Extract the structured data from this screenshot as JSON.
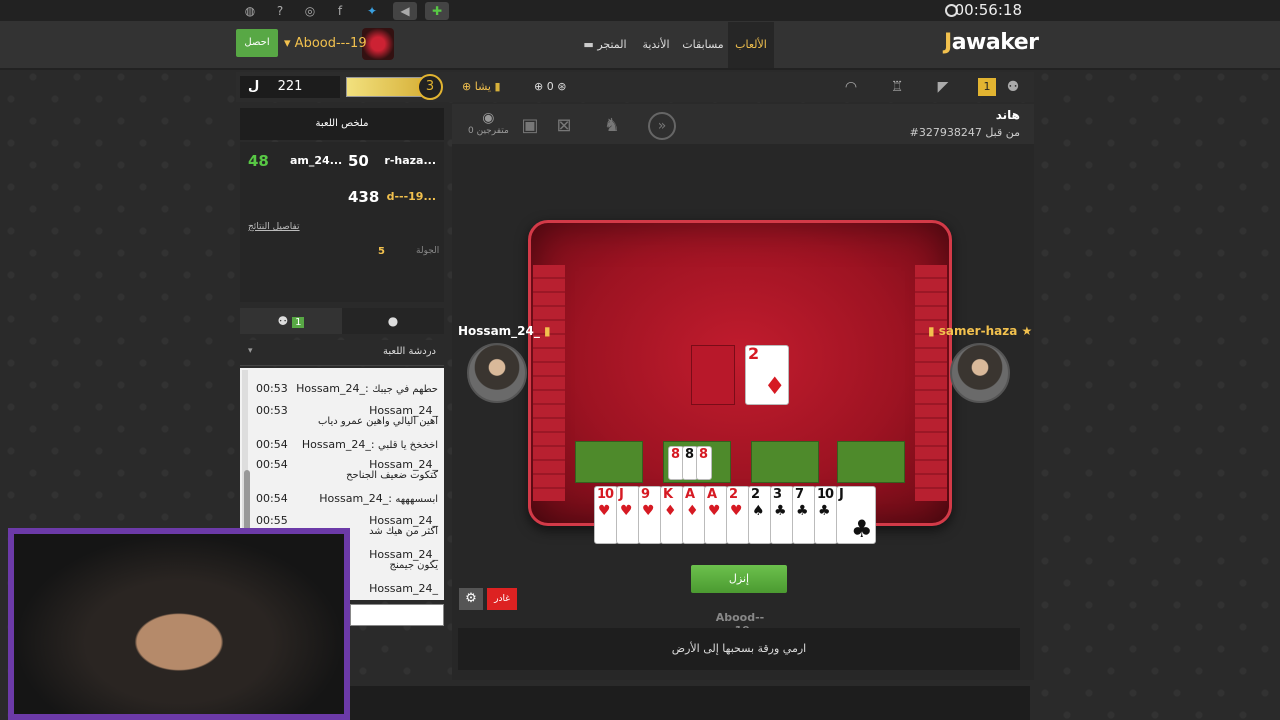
{
  "clock": "00:56:18",
  "header": {
    "logo_pre": "J",
    "logo_rest": "awaker",
    "nav": [
      "الألعاب",
      "مسابقات",
      "الأندية",
      "المتجر"
    ],
    "username": "Abood---19",
    "get_label": "احصل"
  },
  "toolbar": {
    "coins": "221",
    "level": "3",
    "gold_label": "يشا",
    "chips": "0",
    "notif_badge": "1"
  },
  "summary": {
    "title": "ملخص اللعبة",
    "rows": [
      {
        "name": "r-haza...",
        "score": "50"
      },
      {
        "name": "am_24...",
        "score": "48"
      },
      {
        "name": "d---19...",
        "score": "438"
      }
    ],
    "details_link": "تفاصيل النتائج",
    "round_label": "الجولة",
    "round_value": "5"
  },
  "tabs": {
    "friends_count": "1"
  },
  "chat": {
    "title": "دردشة اللعبة",
    "messages": [
      {
        "name": "Hossam_24_",
        "time": "00:53",
        "text": "حطهم في جيبك"
      },
      {
        "name": "Hossam_24_",
        "time": "00:53",
        "text": "اهين اليالي واهين عمرو دياب"
      },
      {
        "name": "Hossam_24_",
        "time": "00:54",
        "text": "اخخخخ يا قلبي"
      },
      {
        "name": "Hossam_24_",
        "time": "00:54",
        "text": "كتكوت ضعيف الجناحح"
      },
      {
        "name": "Hossam_24_",
        "time": "00:54",
        "text": "ابسسهههه"
      },
      {
        "name": "Hossam_24_",
        "time": "00:55",
        "text": "اكثر من هيك شد"
      },
      {
        "name": "Hossam_24_",
        "time": "",
        "text": "يكون جيمنج"
      },
      {
        "name": "Hossam_24_",
        "time": "",
        "text": ""
      }
    ]
  },
  "game": {
    "title": "هاند",
    "id_text": "#327938247 من قبل",
    "spectators": "0 متفرجين",
    "players": {
      "left": "Hossam_24_",
      "right": "samer-haza",
      "self": "Abood---19"
    },
    "discard_card": {
      "rank": "2",
      "suit": "♦"
    },
    "meld_cards": [
      "8",
      "8",
      "8"
    ],
    "hand": [
      {
        "rank": "10",
        "suit": "♥",
        "color": "red"
      },
      {
        "rank": "J",
        "suit": "♥",
        "color": "red"
      },
      {
        "rank": "9",
        "suit": "♥",
        "color": "red"
      },
      {
        "rank": "K",
        "suit": "♦",
        "color": "red"
      },
      {
        "rank": "A",
        "suit": "♦",
        "color": "red"
      },
      {
        "rank": "A",
        "suit": "♥",
        "color": "red"
      },
      {
        "rank": "2",
        "suit": "♥",
        "color": "red"
      },
      {
        "rank": "2",
        "suit": "♠",
        "color": "blk"
      },
      {
        "rank": "3",
        "suit": "♣",
        "color": "blk"
      },
      {
        "rank": "7",
        "suit": "♣",
        "color": "blk"
      },
      {
        "rank": "10",
        "suit": "♣",
        "color": "blk"
      },
      {
        "rank": "J",
        "suit": "♣",
        "color": "blk"
      }
    ],
    "drop_button": "إنزل",
    "leave_button": "غادر",
    "hint": "ارمي ورقة بسحبها إلى الأرض"
  },
  "colors": {
    "accent": "#f2c14e",
    "green": "#58a845",
    "table_red": "#b01a2a",
    "webcam_border": "#6c3aa8"
  }
}
